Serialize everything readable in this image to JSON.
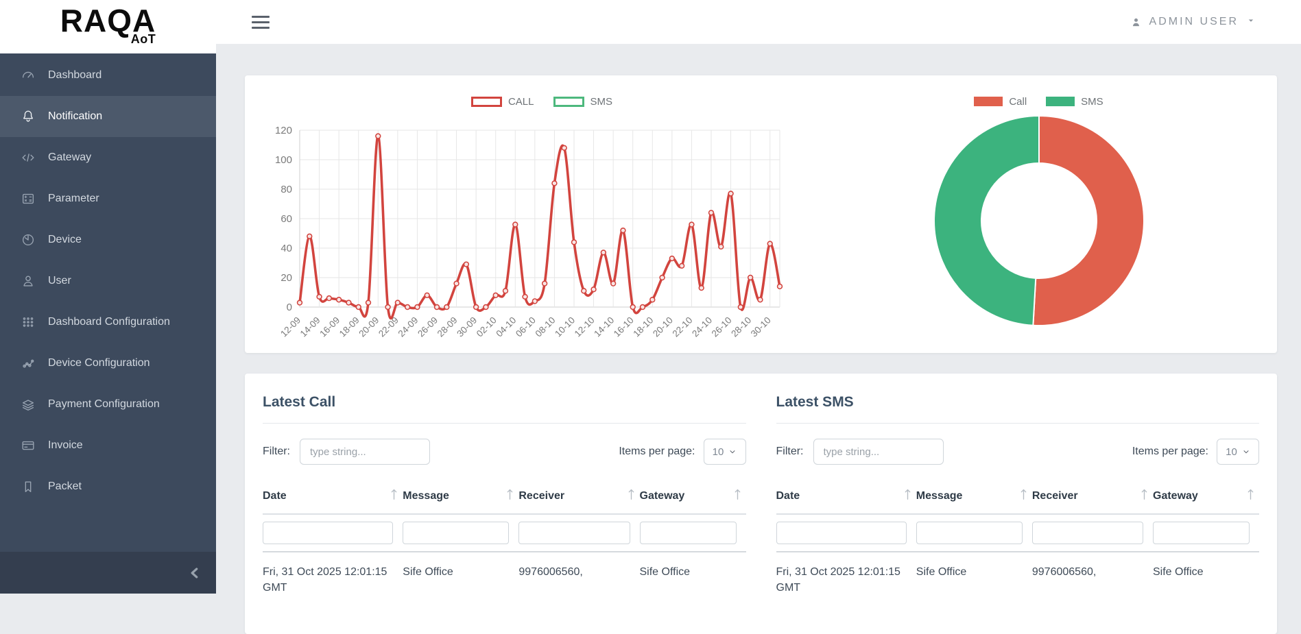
{
  "sidebar": {
    "logo_title": "RAQA",
    "logo_subtitle": "AoT",
    "items": [
      {
        "label": "Dashboard",
        "icon": "gauge-icon",
        "active": false
      },
      {
        "label": "Notification",
        "icon": "bell-icon",
        "active": true
      },
      {
        "label": "Gateway",
        "icon": "code-icon",
        "active": false
      },
      {
        "label": "Parameter",
        "icon": "calculator-icon",
        "active": false
      },
      {
        "label": "Device",
        "icon": "device-clock-icon",
        "active": false
      },
      {
        "label": "User",
        "icon": "person-icon",
        "active": false
      },
      {
        "label": "Dashboard Configuration",
        "icon": "grid-dots-icon",
        "active": false
      },
      {
        "label": "Device Configuration",
        "icon": "nodes-icon",
        "active": false
      },
      {
        "label": "Payment Configuration",
        "icon": "layers-icon",
        "active": false
      },
      {
        "label": "Invoice",
        "icon": "credit-card-icon",
        "active": false
      },
      {
        "label": "Packet",
        "icon": "bookmark-icon",
        "active": false
      }
    ]
  },
  "topbar": {
    "user_label": "ADMIN USER"
  },
  "chart_data": [
    {
      "type": "line",
      "title": "",
      "legend_position": "top",
      "grid": true,
      "ylim": [
        0,
        120
      ],
      "yticks": [
        0,
        20,
        40,
        60,
        80,
        100,
        120
      ],
      "x_tick_every": 2,
      "x": [
        "12-09",
        "13-09",
        "14-09",
        "15-09",
        "16-09",
        "17-09",
        "18-09",
        "19-09",
        "20-09",
        "21-09",
        "22-09",
        "23-09",
        "24-09",
        "25-09",
        "26-09",
        "27-09",
        "28-09",
        "29-09",
        "30-09",
        "01-10",
        "02-10",
        "03-10",
        "04-10",
        "05-10",
        "06-10",
        "07-10",
        "08-10",
        "09-10",
        "10-10",
        "11-10",
        "12-10",
        "13-10",
        "14-10",
        "15-10",
        "16-10",
        "17-10",
        "18-10",
        "19-10",
        "20-10",
        "21-10",
        "22-10",
        "23-10",
        "24-10",
        "25-10",
        "26-10",
        "27-10",
        "28-10",
        "29-10",
        "30-10",
        "31-10"
      ],
      "series": [
        {
          "name": "CALL",
          "color": "#d2443e",
          "values": [
            3,
            48,
            7,
            6,
            5,
            3,
            0,
            3,
            116,
            0,
            3,
            0,
            0,
            8,
            0,
            0,
            16,
            29,
            0,
            0,
            8,
            11,
            56,
            7,
            4,
            16,
            84,
            108,
            44,
            11,
            12,
            37,
            16,
            52,
            0,
            0,
            5,
            20,
            33,
            28,
            56,
            13,
            64,
            41,
            77,
            0,
            20,
            5,
            43,
            14
          ]
        },
        {
          "name": "SMS",
          "color": "#4db87d",
          "values": []
        }
      ]
    },
    {
      "type": "pie",
      "style": "doughnut",
      "legend_position": "top",
      "labels": [
        "Call",
        "SMS"
      ],
      "values": [
        50.9,
        49.1
      ],
      "colors": [
        "#e0604c",
        "#3cb37e"
      ]
    }
  ],
  "panels": {
    "call": {
      "title": "Latest Call",
      "filter_label": "Filter:",
      "filter_placeholder": "type string...",
      "items_per_page_label": "Items per page:",
      "items_per_page_value": "10",
      "columns": [
        "Date",
        "Message",
        "Receiver",
        "Gateway"
      ],
      "rows": [
        [
          "Fri, 31 Oct 2025 12:01:15 GMT",
          "Sife Office",
          "9976006560,",
          "Sife Office"
        ]
      ]
    },
    "sms": {
      "title": "Latest SMS",
      "filter_label": "Filter:",
      "filter_placeholder": "type string...",
      "items_per_page_label": "Items per page:",
      "items_per_page_value": "10",
      "columns": [
        "Date",
        "Message",
        "Receiver",
        "Gateway"
      ],
      "rows": [
        [
          "Fri, 31 Oct 2025 12:01:15 GMT",
          "Sife Office",
          "9976006560,",
          "Sife Office"
        ]
      ]
    }
  }
}
